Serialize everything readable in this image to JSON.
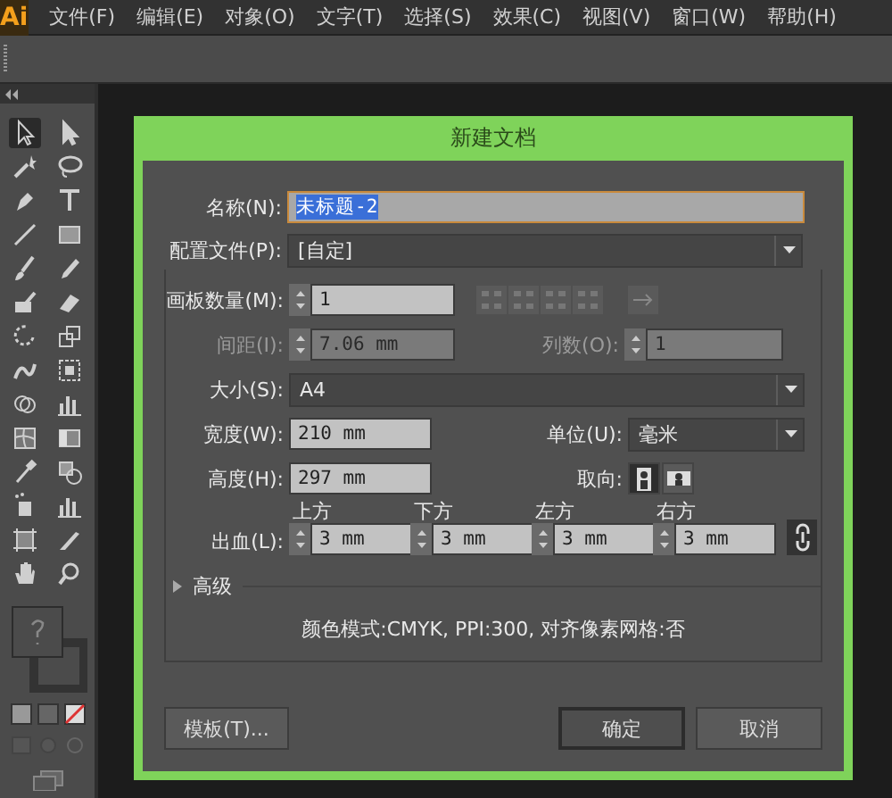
{
  "menu_bar": {
    "logo": "Ai",
    "items": [
      "文件(F)",
      "编辑(E)",
      "对象(O)",
      "文字(T)",
      "选择(S)",
      "效果(C)",
      "视图(V)",
      "窗口(W)",
      "帮助(H)"
    ]
  },
  "dialog": {
    "title": "新建文档",
    "name": {
      "label": "名称(N):",
      "value": "未标题-2",
      "selected": true
    },
    "profile": {
      "label": "配置文件(P):",
      "value": "[自定]"
    },
    "artboards": {
      "label": "画板数量(M):",
      "value": "1"
    },
    "spacing": {
      "label": "间距(I):",
      "value": "7.06 mm",
      "disabled": true
    },
    "columns": {
      "label": "列数(O):",
      "value": "1",
      "disabled": true
    },
    "size": {
      "label": "大小(S):",
      "value": "A4"
    },
    "width": {
      "label": "宽度(W):",
      "value": "210 mm"
    },
    "units": {
      "label": "单位(U):",
      "value": "毫米"
    },
    "height": {
      "label": "高度(H):",
      "value": "297 mm"
    },
    "orientation": {
      "label": "取向:",
      "options": [
        {
          "kind": "portrait",
          "selected": true
        },
        {
          "kind": "landscape",
          "selected": false
        }
      ]
    },
    "bleed": {
      "label": "出血(L):",
      "linked": true,
      "fields": [
        {
          "label": "上方",
          "value": "3 mm"
        },
        {
          "label": "下方",
          "value": "3 mm"
        },
        {
          "label": "左方",
          "value": "3 mm"
        },
        {
          "label": "右方",
          "value": "3 mm"
        }
      ]
    },
    "advanced": {
      "label": "高级",
      "expanded": false
    },
    "info": "颜色模式:CMYK, PPI:300, 对齐像素网格:否",
    "buttons": [
      {
        "label": "模板(T)...",
        "kind": "template",
        "default": false
      },
      {
        "label": "确定",
        "kind": "ok",
        "default": true
      },
      {
        "label": "取消",
        "kind": "cancel",
        "default": false
      }
    ]
  }
}
